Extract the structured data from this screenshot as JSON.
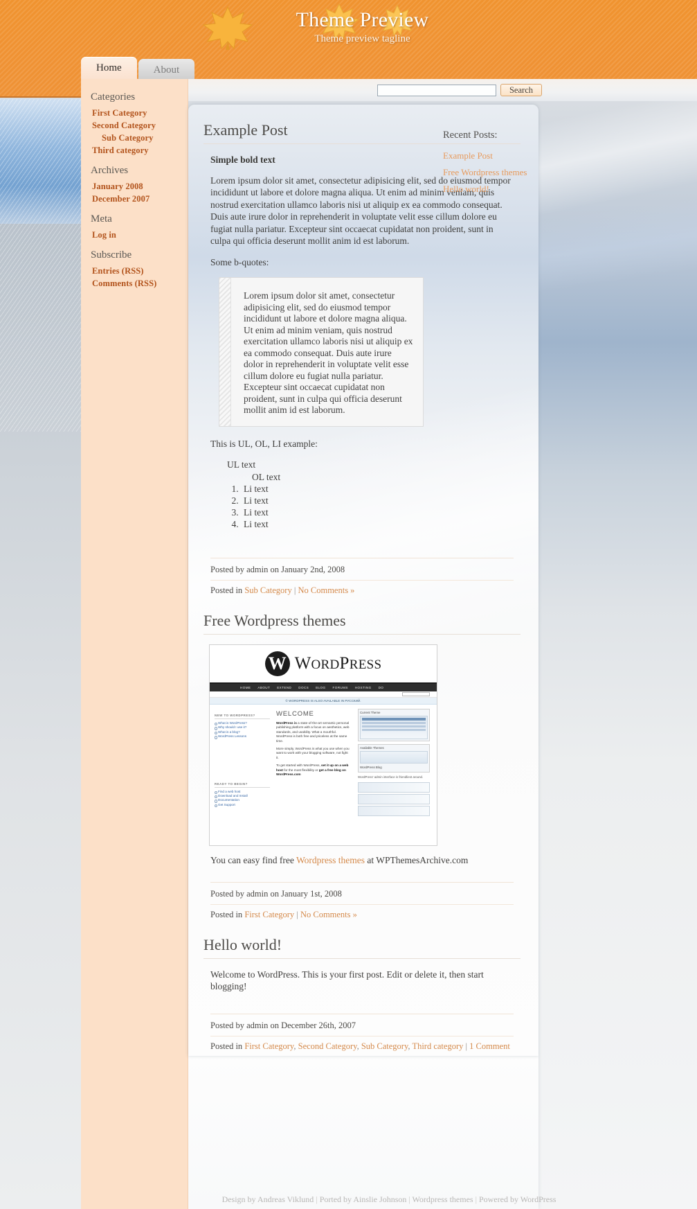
{
  "site": {
    "title": "Theme Preview",
    "tagline": "Theme preview tagline",
    "accent_orange": "#f0932f",
    "link_orange": "#b2531c",
    "sidebar_bg": "#fce0c8"
  },
  "nav": {
    "tabs": [
      {
        "label": "Home",
        "active": true
      },
      {
        "label": "About",
        "active": false
      }
    ]
  },
  "search": {
    "value": "",
    "placeholder": "",
    "button_label": "Search"
  },
  "sidebar": {
    "sections": [
      {
        "heading": "Categories",
        "items": [
          {
            "label": "First Category",
            "indent": false
          },
          {
            "label": "Second Category",
            "indent": false
          },
          {
            "label": "Sub Category",
            "indent": true
          },
          {
            "label": "Third category",
            "indent": false
          }
        ]
      },
      {
        "heading": "Archives",
        "items": [
          {
            "label": "January 2008",
            "indent": false
          },
          {
            "label": "December 2007",
            "indent": false
          }
        ]
      },
      {
        "heading": "Meta",
        "items": [
          {
            "label": "Log in",
            "indent": false
          }
        ]
      },
      {
        "heading": "Subscribe",
        "items": [
          {
            "label": "Entries (RSS)",
            "indent": false
          },
          {
            "label": "Comments (RSS)",
            "indent": false
          }
        ]
      }
    ]
  },
  "right_column": {
    "heading": "Recent Posts:",
    "items": [
      {
        "label": "Example Post"
      },
      {
        "label": "Free Wordpress themes"
      },
      {
        "label": "Hello world!"
      }
    ]
  },
  "posts": [
    {
      "title": "Example Post",
      "bold_lead": "Simple bold text",
      "paragraph": "Lorem ipsum dolor sit amet, consectetur adipisicing elit, sed do eiusmod tempor incididunt ut labore et dolore magna aliqua. Ut enim ad minim veniam, quis nostrud exercitation ullamco laboris nisi ut aliquip ex ea commodo consequat. Duis aute irure dolor in reprehenderit in voluptate velit esse cillum dolore eu fugiat nulla pariatur. Excepteur sint occaecat cupidatat non proident, sunt in culpa qui officia deserunt mollit anim id est laborum.",
      "quote_intro": "Some b-quotes:",
      "blockquote": "Lorem ipsum dolor sit amet, consectetur adipisicing elit, sed do eiusmod tempor incididunt ut labore et dolore magna aliqua. Ut enim ad minim veniam, quis nostrud exercitation ullamco laboris nisi ut aliquip ex ea commodo consequat. Duis aute irure dolor in reprehenderit in voluptate velit esse cillum dolore eu fugiat nulla pariatur. Excepteur sint occaecat cupidatat non proident, sunt in culpa qui officia deserunt mollit anim id est laborum.",
      "list_intro": "This is UL, OL, LI example:",
      "ul_text": "UL text",
      "ol_text": "OL text",
      "li_items": [
        "Li text",
        "Li text",
        "Li text",
        "Li text"
      ],
      "meta_posted": "Posted by admin on January 2nd, 2008",
      "meta_in_label": "Posted in",
      "categories": [
        "Sub Category"
      ],
      "comments_label": "No Comments »"
    },
    {
      "title": "Free Wordpress themes",
      "caption_prefix": "You can easy find free ",
      "caption_link": "Wordpress themes",
      "caption_suffix": " at WPThemesArchive.com",
      "meta_posted": "Posted by admin on January 1st, 2008",
      "meta_in_label": "Posted in",
      "categories": [
        "First Category"
      ],
      "comments_label": "No Comments »"
    },
    {
      "title": "Hello world!",
      "paragraph": "Welcome to WordPress. This is your first post. Edit or delete it, then start blogging!",
      "meta_posted": "Posted by admin on December 26th, 2007",
      "meta_in_label": "Posted in",
      "categories": [
        "First Category",
        "Second Category",
        "Sub Category",
        "Third category"
      ],
      "comments_label": "1 Comment »"
    }
  ],
  "wp_screenshot": {
    "brand_mark": "W",
    "brand_word": "ORD",
    "brand_word2": "RESS",
    "brand_p": "P",
    "nav_items": [
      "HOME",
      "ABOUT",
      "EXTEND",
      "DOCS",
      "BLOG",
      "FORUMS",
      "HOSTING",
      "DO"
    ],
    "russian_notice": "© WORDPRESS IS ALSO AVAILABLE IN РУССКИЙ.",
    "welcome_heading": "WELCOME",
    "col1_label1": "NEW TO WORDPRESS?",
    "col1_links1": [
      "What is WordPress?",
      "Why should I use it?",
      "What is a blog?",
      "WordPress Lessons"
    ],
    "col1_label2": "READY TO BEGIN?",
    "col1_links2": [
      "Find a web host",
      "Download and Install",
      "Documentation",
      "Get Support"
    ],
    "col2_p1_bold": "WordPress is",
    "col2_p1": " a state-of-the-art semantic personal publishing platform with a focus on aesthetics, web standards, and usability. What a mouthful. WordPress is both free and priceless at the same time.",
    "col2_p2": "More simply, WordPress is what you use when you want to work with your blogging software, not fight it.",
    "col2_p3a": "To get started with WordPress, ",
    "col2_p3b": "set it up on a web host",
    "col2_p3c": " for the most flexibility or ",
    "col2_p3d": "get a free blog on WordPress.com",
    "col3_label": "Current Theme",
    "col3_avail": "Available Themes",
    "col3_theme": "WordPress Blog",
    "col3_caption": "WordPress' admin interface is friendliest around."
  },
  "footer": {
    "parts": [
      {
        "text": "Design by Andreas Viklund",
        "link": true
      },
      {
        "text": " | ",
        "link": false
      },
      {
        "text": "Ported by Ainslie Johnson",
        "link": true
      },
      {
        "text": " | ",
        "link": false
      },
      {
        "text": "Wordpress themes",
        "link": true
      },
      {
        "text": " | ",
        "link": false
      },
      {
        "text": "Powered by WordPress",
        "link": true
      }
    ]
  }
}
